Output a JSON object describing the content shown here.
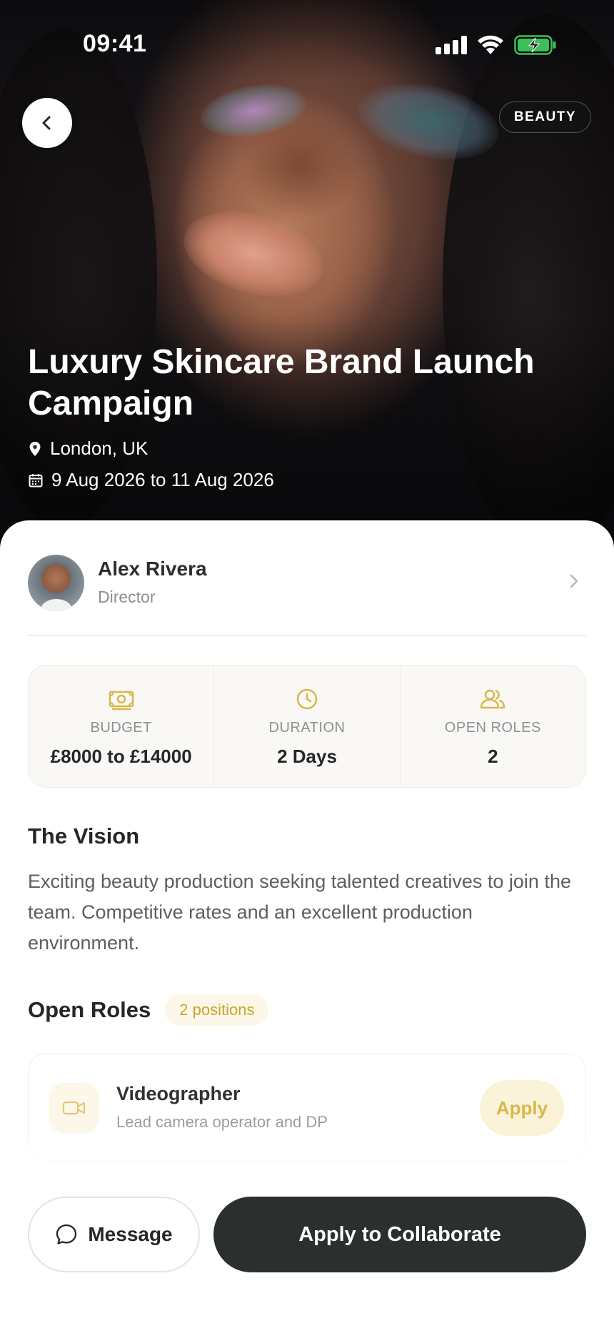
{
  "status_bar": {
    "time": "09:41"
  },
  "hero": {
    "category_tag": "BEAUTY",
    "title": "Luxury Skincare Brand Launch Campaign",
    "location": "London, UK",
    "dates": "9 Aug 2026 to 11 Aug 2026"
  },
  "director": {
    "name": "Alex Rivera",
    "role": "Director"
  },
  "stats": [
    {
      "icon": "money-icon",
      "label": "BUDGET",
      "value": "£8000 to £14000"
    },
    {
      "icon": "clock-icon",
      "label": "DURATION",
      "value": "2 Days"
    },
    {
      "icon": "people-icon",
      "label": "OPEN ROLES",
      "value": "2"
    }
  ],
  "vision": {
    "title": "The Vision",
    "text": "Exciting beauty production seeking talented creatives to join the team. Competitive rates and an excellent production environment."
  },
  "open_roles": {
    "title": "Open Roles",
    "badge": "2 positions",
    "roles": [
      {
        "title": "Videographer",
        "description": "Lead camera operator and DP",
        "action": "Apply",
        "icon": "video-camera-icon"
      }
    ]
  },
  "actions": {
    "message": "Message",
    "apply": "Apply to Collaborate"
  },
  "colors": {
    "accent": "#d6b84c",
    "primary_button": "#2b2f2e",
    "badge_bg": "#fcf7e8"
  }
}
